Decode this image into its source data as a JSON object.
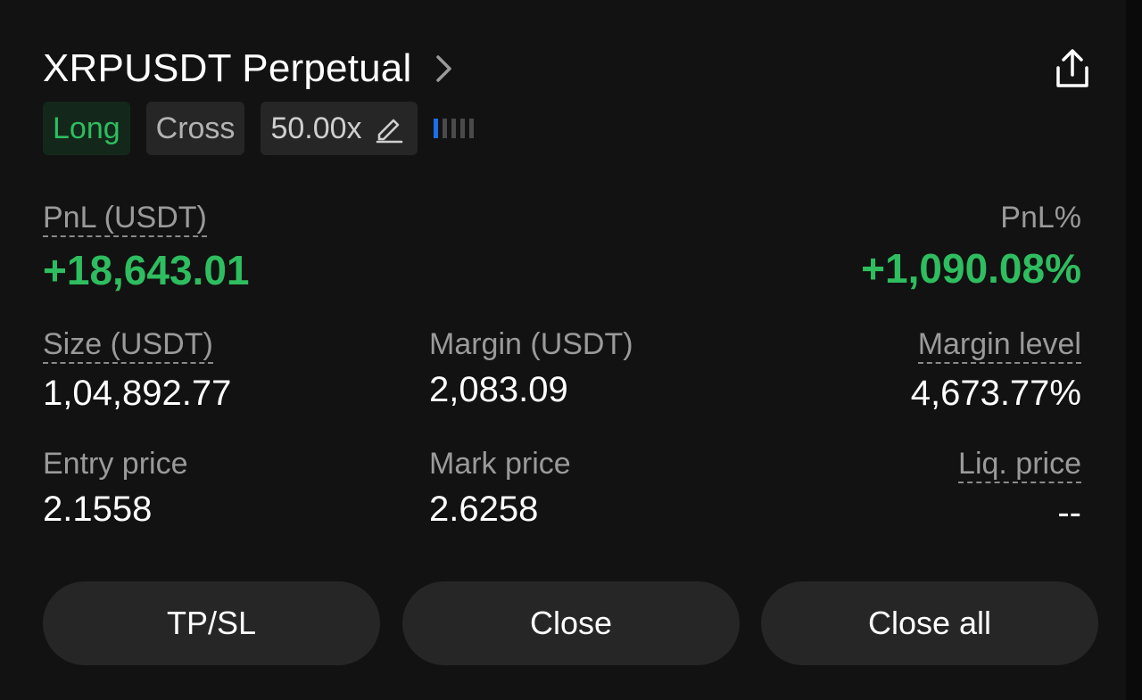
{
  "header": {
    "title": "XRPUSDT Perpetual",
    "chevron_icon": "chevron-right-icon",
    "share_icon": "share-icon"
  },
  "tags": {
    "side": "Long",
    "margin_mode": "Cross",
    "leverage": "50.00x",
    "edit_icon": "pencil-icon",
    "risk_level_bars": 5,
    "risk_level_active": 1
  },
  "pnl": {
    "label": "PnL (USDT)",
    "value": "+18,643.01",
    "pct_label": "PnL%",
    "pct_value": "+1,090.08%"
  },
  "stats": {
    "size_label": "Size (USDT)",
    "size_value": "1,04,892.77",
    "margin_label": "Margin (USDT)",
    "margin_value": "2,083.09",
    "margin_level_label": "Margin level",
    "margin_level_value": "4,673.77%",
    "entry_label": "Entry price",
    "entry_value": "2.1558",
    "mark_label": "Mark price",
    "mark_value": "2.6258",
    "liq_label": "Liq. price",
    "liq_value": "--"
  },
  "actions": {
    "tpsl": "TP/SL",
    "close": "Close",
    "close_all": "Close all"
  },
  "colors": {
    "background": "#121212",
    "positive": "#2ebd5f",
    "accent": "#1e6ee8",
    "button_bg": "#262626"
  }
}
